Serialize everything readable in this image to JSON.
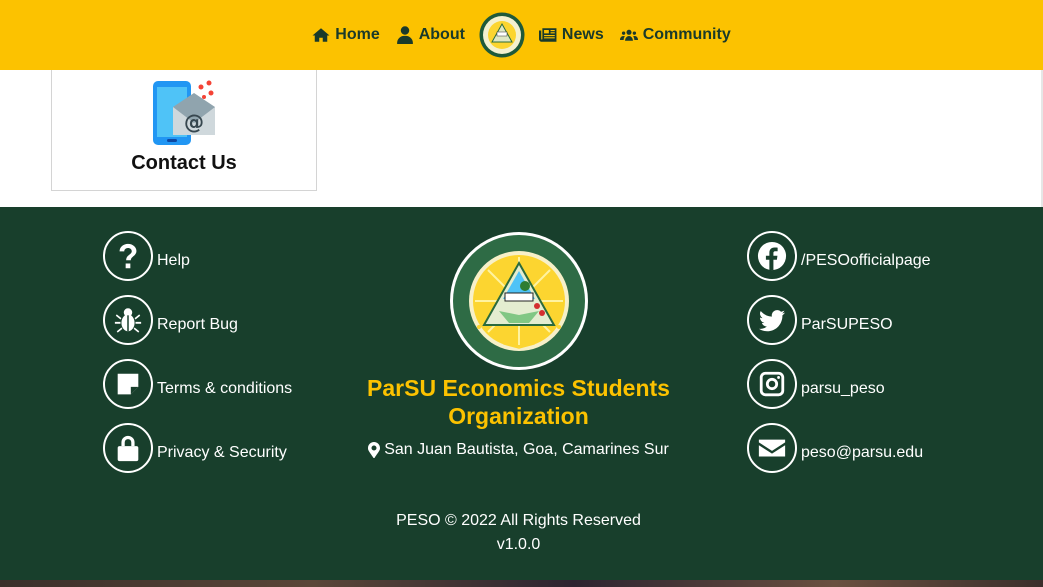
{
  "navbar": {
    "home_label": "Home",
    "about_label": "About",
    "news_label": "News",
    "community_label": "Community",
    "background": "#fcc200"
  },
  "card": {
    "label": "Contact Us",
    "icon": "contact-phone-mail-icon"
  },
  "footer": {
    "background": "#183f2c",
    "accent": "#fcc200",
    "left_links": [
      {
        "label": "Help",
        "icon": "question-icon"
      },
      {
        "label": "Report Bug",
        "icon": "bug-icon"
      },
      {
        "label": "Terms & conditions",
        "icon": "sticky-note-icon"
      },
      {
        "label": "Privacy & Security",
        "icon": "lock-icon"
      }
    ],
    "right_links": [
      {
        "label": "/PESOofficialpage",
        "icon": "facebook-icon"
      },
      {
        "label": "ParSUPESO",
        "icon": "twitter-icon"
      },
      {
        "label": "parsu_peso",
        "icon": "instagram-icon"
      },
      {
        "label": "peso@parsu.edu",
        "icon": "envelope-icon"
      }
    ],
    "org_name": "ParSU Economics Students Organization",
    "address": "San Juan Bautista, Goa, Camarines Sur",
    "copyright": "PESO © 2022 All Rights Reserved",
    "version": "v1.0.0"
  }
}
